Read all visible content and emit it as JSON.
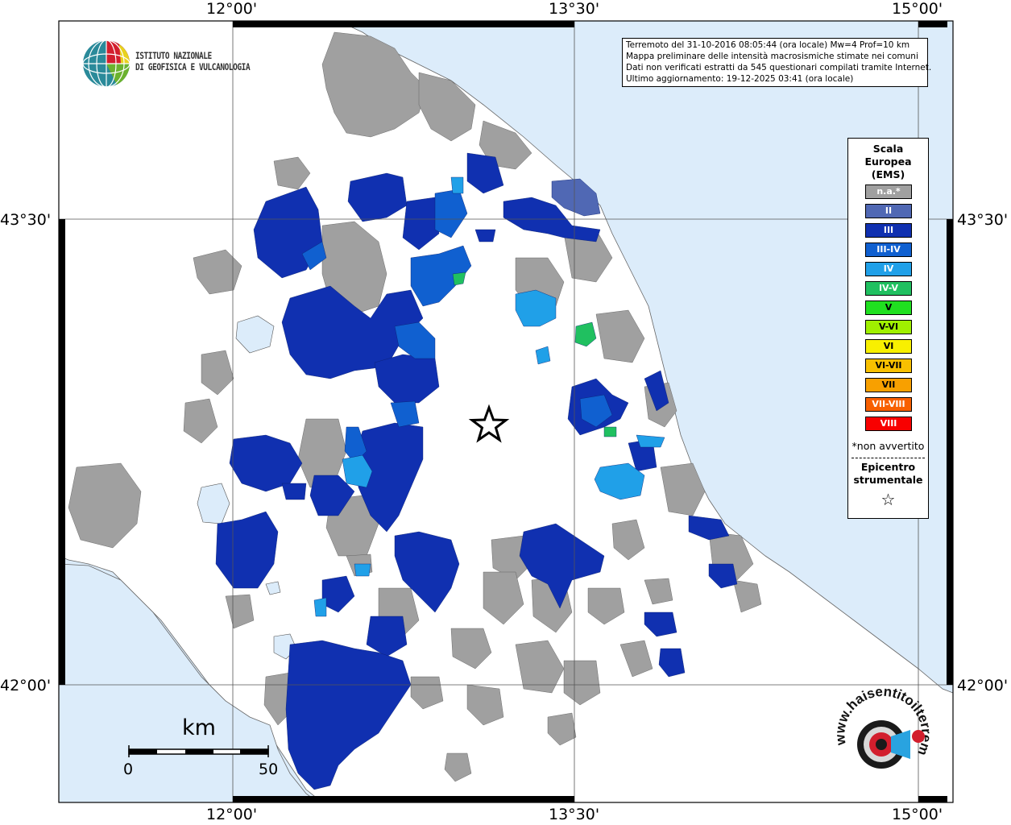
{
  "map": {
    "lon_ticks": [
      "12°00'",
      "13°30'",
      "15°00'"
    ],
    "lat_ticks": [
      "43°30'",
      "42°00'"
    ]
  },
  "info": {
    "line1": "Terremoto del 31-10-2016 08:05:44 (ora locale) Mw=4 Prof=10 km",
    "line2": "Mappa preliminare delle intensità macrosismiche stimate nei comuni",
    "line3": "Dati non verificati estratti da 545 questionari compilati tramite Internet.",
    "line4": "Ultimo aggiornamento: 19-12-2025 03:41 (ora locale)"
  },
  "logo": {
    "line1": "ISTITUTO NAZIONALE",
    "line2": "DI GEOFISICA E VULCANOLOGIA"
  },
  "legend": {
    "title1": "Scala",
    "title2": "Europea",
    "title3": "(EMS)",
    "items": [
      {
        "label": "n.a.*",
        "color": "#a0a0a0"
      },
      {
        "label": "II",
        "color": "#5068b4"
      },
      {
        "label": "III",
        "color": "#1030b0"
      },
      {
        "label": "III-IV",
        "color": "#1060d0"
      },
      {
        "label": "IV",
        "color": "#20a0e8"
      },
      {
        "label": "IV-V",
        "color": "#20c060"
      },
      {
        "label": "V",
        "color": "#20e020"
      },
      {
        "label": "V-VI",
        "color": "#a0f000"
      },
      {
        "label": "VI",
        "color": "#f8f000"
      },
      {
        "label": "VI-VII",
        "color": "#f8c000"
      },
      {
        "label": "VII",
        "color": "#f8a000"
      },
      {
        "label": "VII-VIII",
        "color": "#f86000"
      },
      {
        "label": "VIII",
        "color": "#f80000"
      }
    ],
    "note": "*non avvertito",
    "epicenter1": "Epicentro",
    "epicenter2": "strumentale",
    "star": "☆"
  },
  "scalebar": {
    "unit": "km",
    "start": "0",
    "end": "50"
  },
  "watermark": {
    "text": "www.haisentitoilterremoto.it"
  },
  "colors": {
    "sea": "#dcecfa",
    "land": "#ffffff",
    "na": "#a0a0a0",
    "II": "#5068b4",
    "III": "#1030b0",
    "III-IV": "#1060d0",
    "IV": "#20a0e8",
    "IV-V": "#20c060"
  }
}
